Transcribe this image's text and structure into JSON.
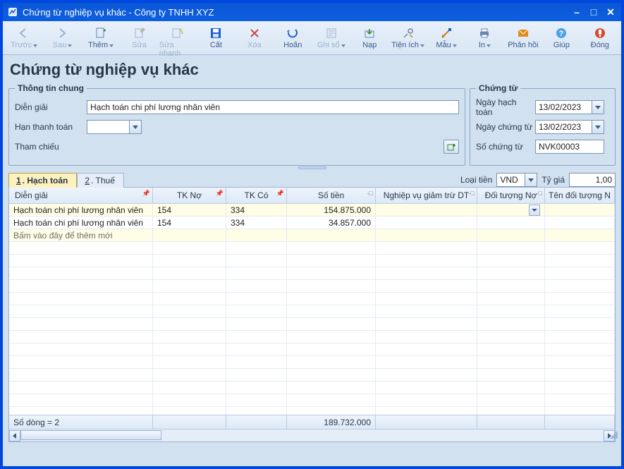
{
  "window": {
    "title": "Chứng từ nghiệp vụ khác - Công ty TNHH XYZ"
  },
  "toolbar": {
    "prev": "Trước",
    "next": "Sau",
    "add": "Thêm",
    "edit": "Sửa",
    "quickedit": "Sửa nhanh",
    "cut": "Cất",
    "delete": "Xóa",
    "undo": "Hoãn",
    "write": "Ghi sổ",
    "load": "Nạp",
    "utility": "Tiện ích",
    "template": "Mẫu",
    "print": "In",
    "feedback": "Phản hồi",
    "help": "Giúp",
    "close": "Đóng"
  },
  "page": {
    "title": "Chứng từ nghiệp vụ khác"
  },
  "general": {
    "legend": "Thông tin chung",
    "desc_label": "Diễn giải",
    "desc_value": "Hạch toán chi phí lương nhân viên",
    "due_label": "Hạn thanh toán",
    "due_value": "",
    "ref_label": "Tham chiếu"
  },
  "voucher": {
    "legend": "Chứng từ",
    "postdate_label": "Ngày hạch toán",
    "postdate_value": "13/02/2023",
    "vdate_label": "Ngày chứng từ",
    "vdate_value": "13/02/2023",
    "vno_label": "Số chứng từ",
    "vno_value": "NVK00003"
  },
  "tabs": {
    "t1_num": "1",
    "t1_lbl": ". Hạch toán",
    "t2_num": "2",
    "t2_lbl": ". Thuế"
  },
  "currency": {
    "label": "Loại tiền",
    "value": "VND",
    "rate_label": "Tỷ giá",
    "rate_value": "1,00"
  },
  "grid": {
    "headers": {
      "desc": "Diễn giải",
      "tkno": "TK Nợ",
      "tkco": "TK Có",
      "amount": "Số tiền",
      "ngv": "Nghiệp vụ giảm trừ DT",
      "dtn": "Đối tượng Nợ",
      "tdt": "Tên đối tượng N"
    },
    "rows": [
      {
        "desc": "Hạch toán chi phí lương nhân viên",
        "tkno": "154",
        "tkco": "334",
        "amount": "154.875.000",
        "ngv": "",
        "dtn": "",
        "tdt": ""
      },
      {
        "desc": "Hạch toán chi phí lương nhân viên",
        "tkno": "154",
        "tkco": "334",
        "amount": "34.857.000",
        "ngv": "",
        "dtn": "",
        "tdt": ""
      }
    ],
    "placeholder": "Bấm vào đây để thêm mới",
    "footer": {
      "rowcount": "Số dòng = 2",
      "total": "189.732.000"
    }
  }
}
